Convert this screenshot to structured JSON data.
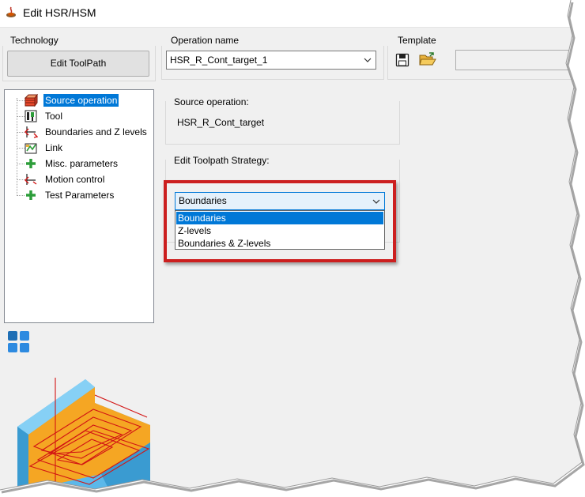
{
  "window": {
    "title": "Edit HSR/HSM"
  },
  "technology": {
    "label": "Technology",
    "edit_button": "Edit ToolPath"
  },
  "operation": {
    "label": "Operation name",
    "value": "HSR_R_Cont_target_1"
  },
  "template": {
    "label": "Template",
    "value": ""
  },
  "tree": {
    "items": [
      {
        "label": "Source operation",
        "icon": "source-operation-icon",
        "selected": true
      },
      {
        "label": "Tool",
        "icon": "tool-icon"
      },
      {
        "label": "Boundaries and Z levels",
        "icon": "boundaries-icon"
      },
      {
        "label": "Link",
        "icon": "link-icon"
      },
      {
        "label": "Misc. parameters",
        "icon": "plus-icon"
      },
      {
        "label": "Motion control",
        "icon": "motion-control-icon"
      },
      {
        "label": "Test Parameters",
        "icon": "plus-icon"
      }
    ]
  },
  "source_operation": {
    "label": "Source operation:",
    "value": "HSR_R_Cont_target"
  },
  "strategy": {
    "label": "Edit Toolpath Strategy:",
    "value": "Boundaries",
    "options": [
      "Boundaries",
      "Z-levels",
      "Boundaries & Z-levels"
    ]
  },
  "colors": {
    "selection": "#0078d7",
    "highlight": "#cc1f1f",
    "part": "#f5a623",
    "part_side": "#5bb8ea"
  }
}
